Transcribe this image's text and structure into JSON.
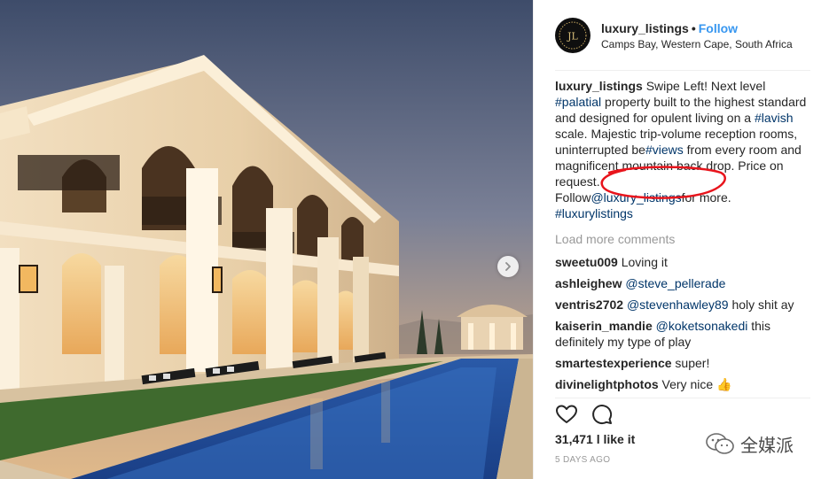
{
  "post": {
    "author": "luxury_listings",
    "follow_label": "Follow",
    "location": "Camps Bay, Western Cape, South Africa",
    "avatar_initials": "JL",
    "caption": {
      "author": "luxury_listings",
      "seg1": "Swipe Left! Next level",
      "tag1": "#palatial",
      "seg2": "property built to the highest standard and designed for opulent living on a",
      "tag2": "#lavish",
      "seg3": "scale. Majestic trip-volume reception rooms, uninterrupted be",
      "tag3": "#views",
      "seg4": "from every room and magnificent mountain back drop. Price on request.",
      "seg5": "Follow",
      "mention": "@luxury_listings",
      "seg6": "for more.",
      "tag4": "#luxurylistings"
    },
    "load_more_label": "Load more comments",
    "comments": [
      {
        "user": "sweetu009",
        "mention": "",
        "text": "Loving it"
      },
      {
        "user": "ashleighew",
        "mention": "@steve_pellerade",
        "text": ""
      },
      {
        "user": "ventris2702",
        "mention": "@stevenhawley89",
        "text": "holy shit ay"
      },
      {
        "user": "kaiserin_mandie",
        "mention": "@koketsonakedi",
        "text": "this definitely my type of play"
      },
      {
        "user": "smartestexperience",
        "mention": "",
        "text": "super!"
      },
      {
        "user": "divinelightphotos",
        "mention": "",
        "text": "Very nice 👍"
      }
    ],
    "likes": "31,471 l like it",
    "timestamp": "5 DAYS AGO",
    "icons": {
      "like": "heart-icon",
      "comment": "comment-icon",
      "next": "chevron-right-icon"
    }
  },
  "watermark": {
    "text": "全媒派"
  },
  "colors": {
    "link": "#003569",
    "follow": "#3897f0",
    "muted": "#999999",
    "annotation": "#e8141c"
  }
}
